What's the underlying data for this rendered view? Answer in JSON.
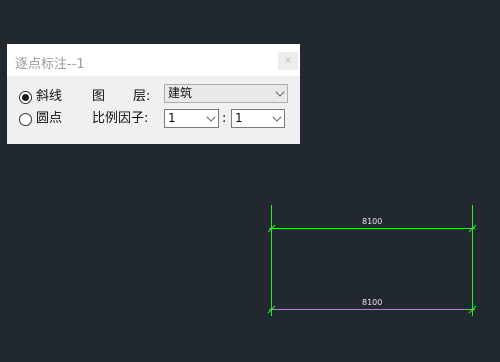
{
  "dialog": {
    "title": "逐点标注--1",
    "close_glyph": "×",
    "options": [
      {
        "label": "斜线",
        "checked": true
      },
      {
        "label": "圆点",
        "checked": false
      }
    ],
    "layer_label_1": "图",
    "layer_label_2": "层:",
    "layer_value": "建筑",
    "scale_label": "比例因子:",
    "scale_left": "1",
    "scale_sep": ":",
    "scale_right": "1"
  },
  "drawing": {
    "dim_top": "8100",
    "dim_bottom": "8100",
    "line_color": "#2ee62e",
    "background": "#212830"
  }
}
